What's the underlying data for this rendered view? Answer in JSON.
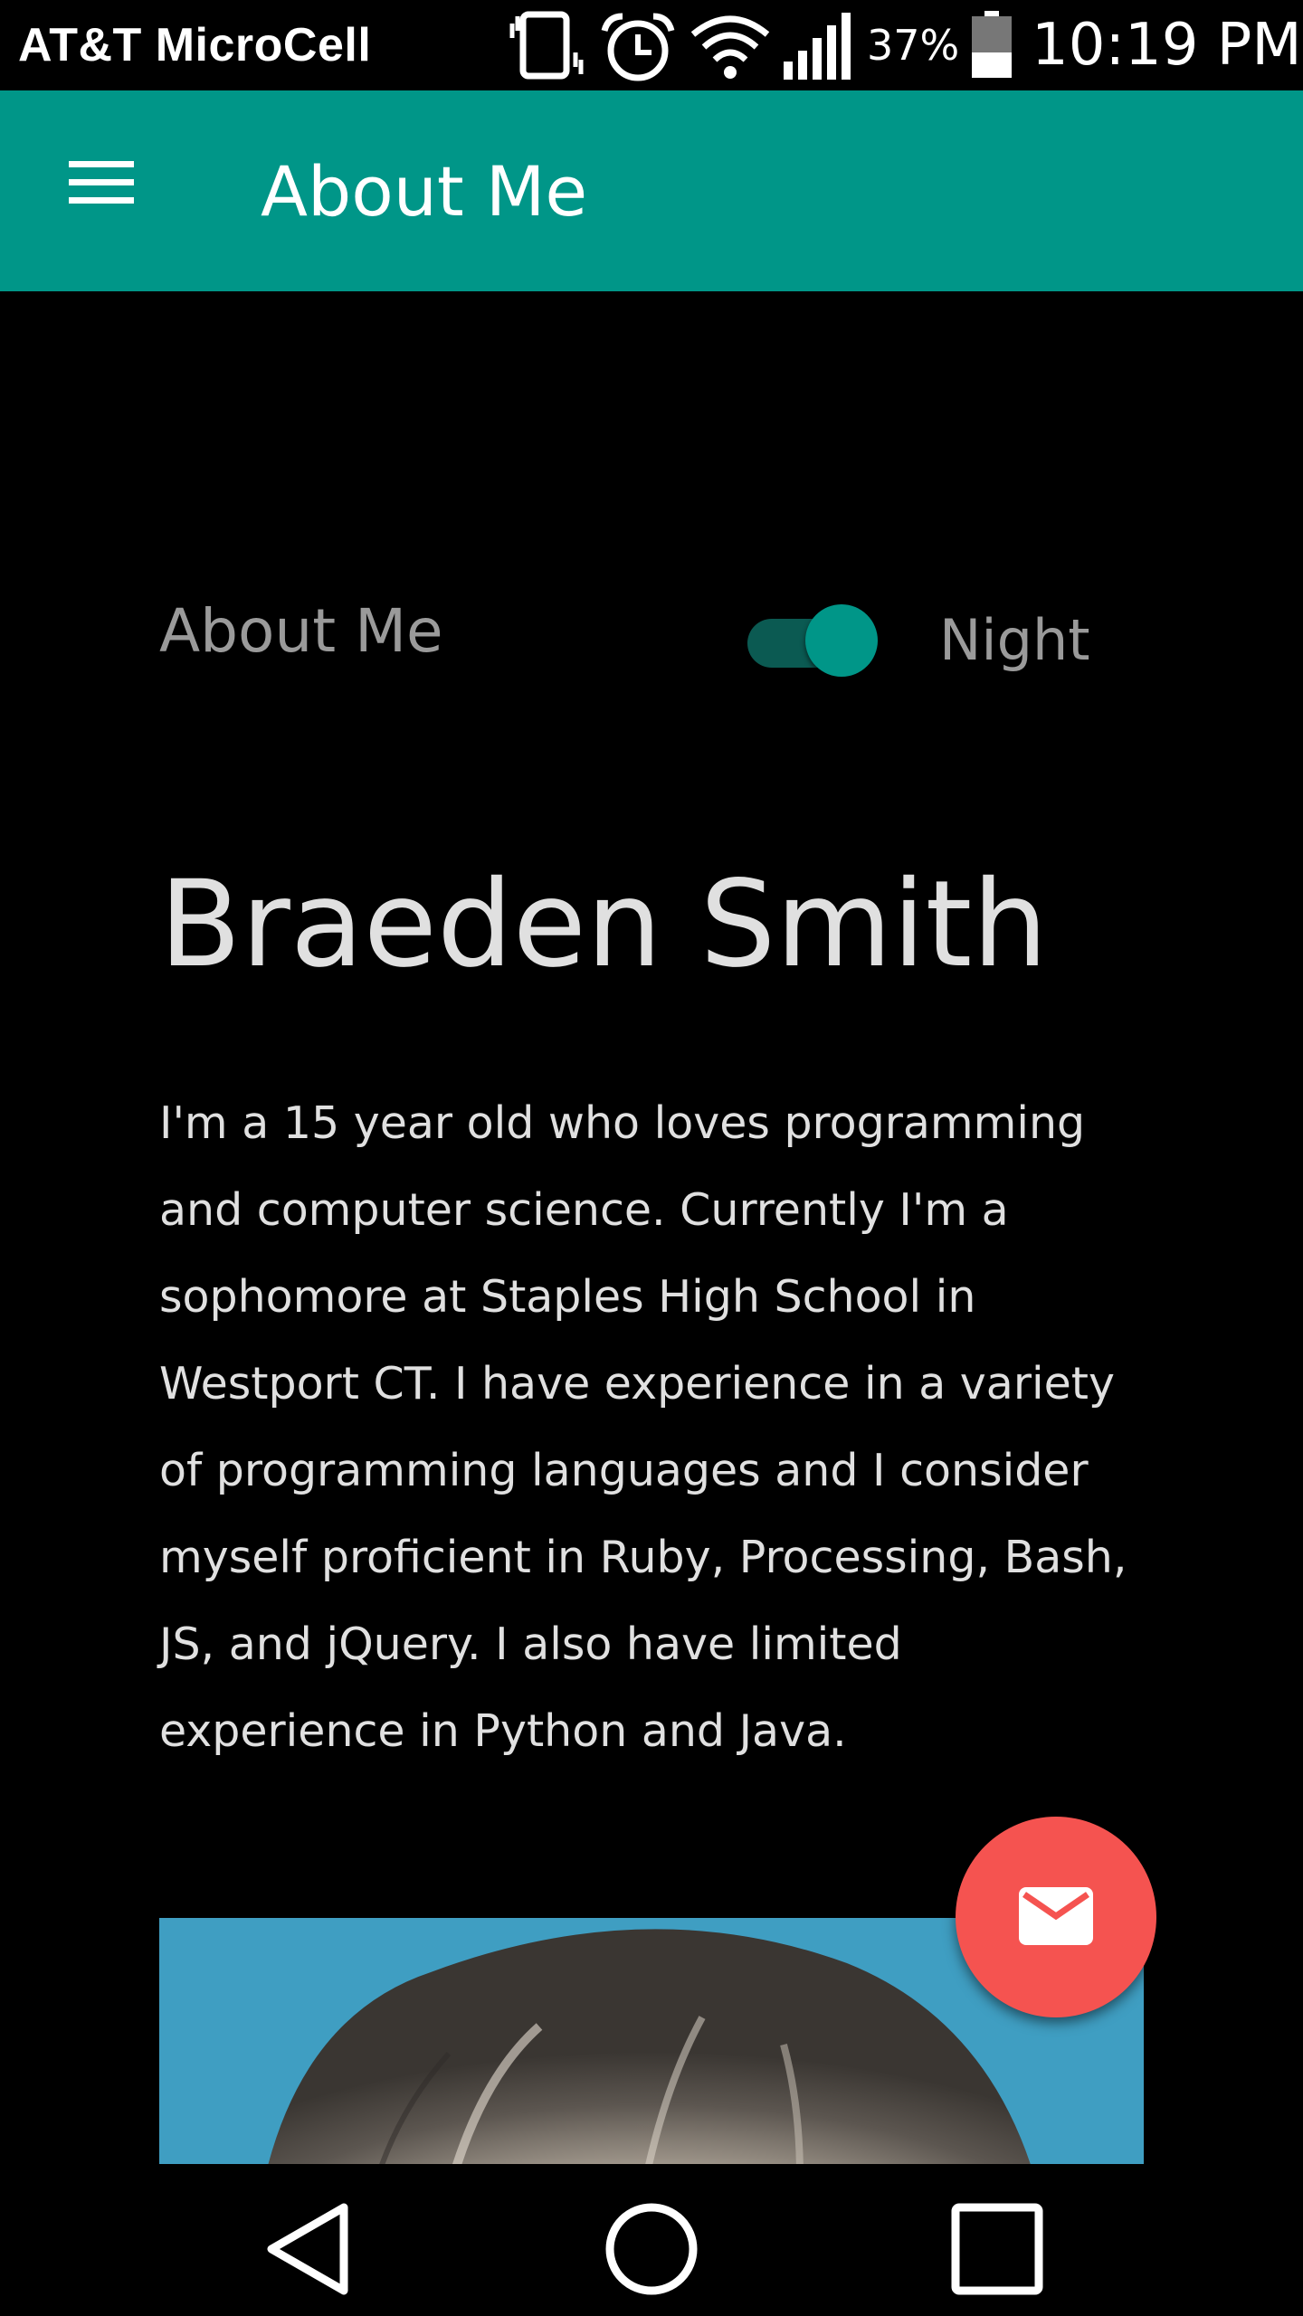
{
  "status_bar": {
    "carrier": "AT&T MicroCell",
    "battery": "37%",
    "time": "10:19 PM",
    "icons": [
      "vibrate-icon",
      "alarm-icon",
      "wifi-icon",
      "signal-icon",
      "battery-icon"
    ]
  },
  "app_bar": {
    "title": "About Me",
    "menu_icon": "hamburger-menu-icon",
    "color": "#009688"
  },
  "main": {
    "section_label": "About Me",
    "theme_switch": {
      "label": "Night",
      "checked": true
    },
    "name": "Braeden Smith",
    "bio": "I'm a 15 year old who loves programming and computer science. Currently I'm a sophomore at Staples High School in Westport CT. I have experience in a variety of programming languages and I consider myself proficient in Ruby, Processing, Bash, JS, and jQuery. I also have limited experience in Python and Java.",
    "fab": {
      "icon": "mail-icon",
      "color": "#f55350"
    }
  },
  "nav_bar": {
    "buttons": [
      "back-icon",
      "home-icon",
      "recents-icon"
    ]
  }
}
